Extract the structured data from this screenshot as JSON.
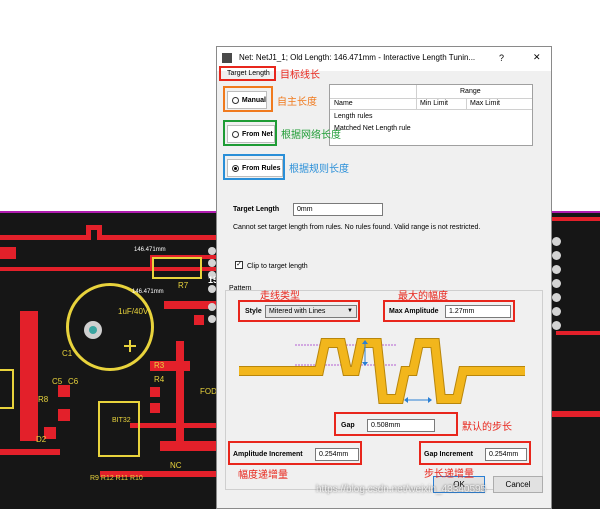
{
  "dialog": {
    "title": "Net: NetJ1_1;  Old Length: 146.471mm  -  Interactive Length Tunin...",
    "help_label": "?",
    "close_label": "✕",
    "target_length_group": "Target Length",
    "rules_table": {
      "group_header": "Range",
      "columns": [
        "Name",
        "Min Limit",
        "Max Limit"
      ],
      "rows": [
        "Length rules",
        "Matched Net Length rule"
      ]
    },
    "radio_manual": "Manual",
    "radio_from_net": "From Net",
    "radio_from_rules": "From Rules",
    "selected_mode": "From Rules",
    "target_length_label": "Target Length",
    "target_length_value": "0mm",
    "rules_message": "Cannot set target length from rules. No rules found. Valid range is not restricted.",
    "clip_label": "Clip to target length",
    "clip_checked": true,
    "pattern_group": "Pattern",
    "style_label": "Style",
    "style_value": "Mitered with Lines",
    "max_amplitude_label": "Max Amplitude",
    "max_amplitude_value": "1.27mm",
    "gap_label": "Gap",
    "gap_value": "0.508mm",
    "amplitude_increment_label": "Amplitude Increment",
    "amplitude_increment_value": "0.254mm",
    "gap_increment_label": "Gap Increment",
    "gap_increment_value": "0.254mm",
    "ok_label": "OK",
    "cancel_label": "Cancel"
  },
  "annotations": {
    "target_length": "目标线长",
    "manual": "自主长度",
    "from_net": "根据网络长度",
    "from_rules": "根据规则长度",
    "style": "走线类型",
    "max_amplitude": "最大的幅度",
    "gap": "默认的步长",
    "amplitude_increment": "幅度递增量",
    "gap_increment": "步长递增量"
  },
  "pcb": {
    "length_label_1": "146.471mm",
    "length_label_2": "146.471mm",
    "cap_label": "1uF/40V",
    "c1": "C1",
    "r7": "R7",
    "r3": "R3",
    "r4": "R4",
    "c5": "C5",
    "c6": "C6",
    "r8": "R8",
    "d2": "D2",
    "bit32": "BIT32",
    "fod": "FOD",
    "nc": "NC",
    "bottom_refs": "R9 R12 R11 R10",
    "side_number": "15"
  },
  "watermark": "https://blog.csdn.net/weixin_43340595",
  "colors": {
    "annotation_red": "#e8261c",
    "annotation_orange": "#f07a1e",
    "annotation_green": "#1e9c35",
    "annotation_blue": "#2a8fd8",
    "trace_yellow": "#f2b61c",
    "pcb_red": "#e3202a",
    "pcb_yellow": "#e8d33c"
  }
}
